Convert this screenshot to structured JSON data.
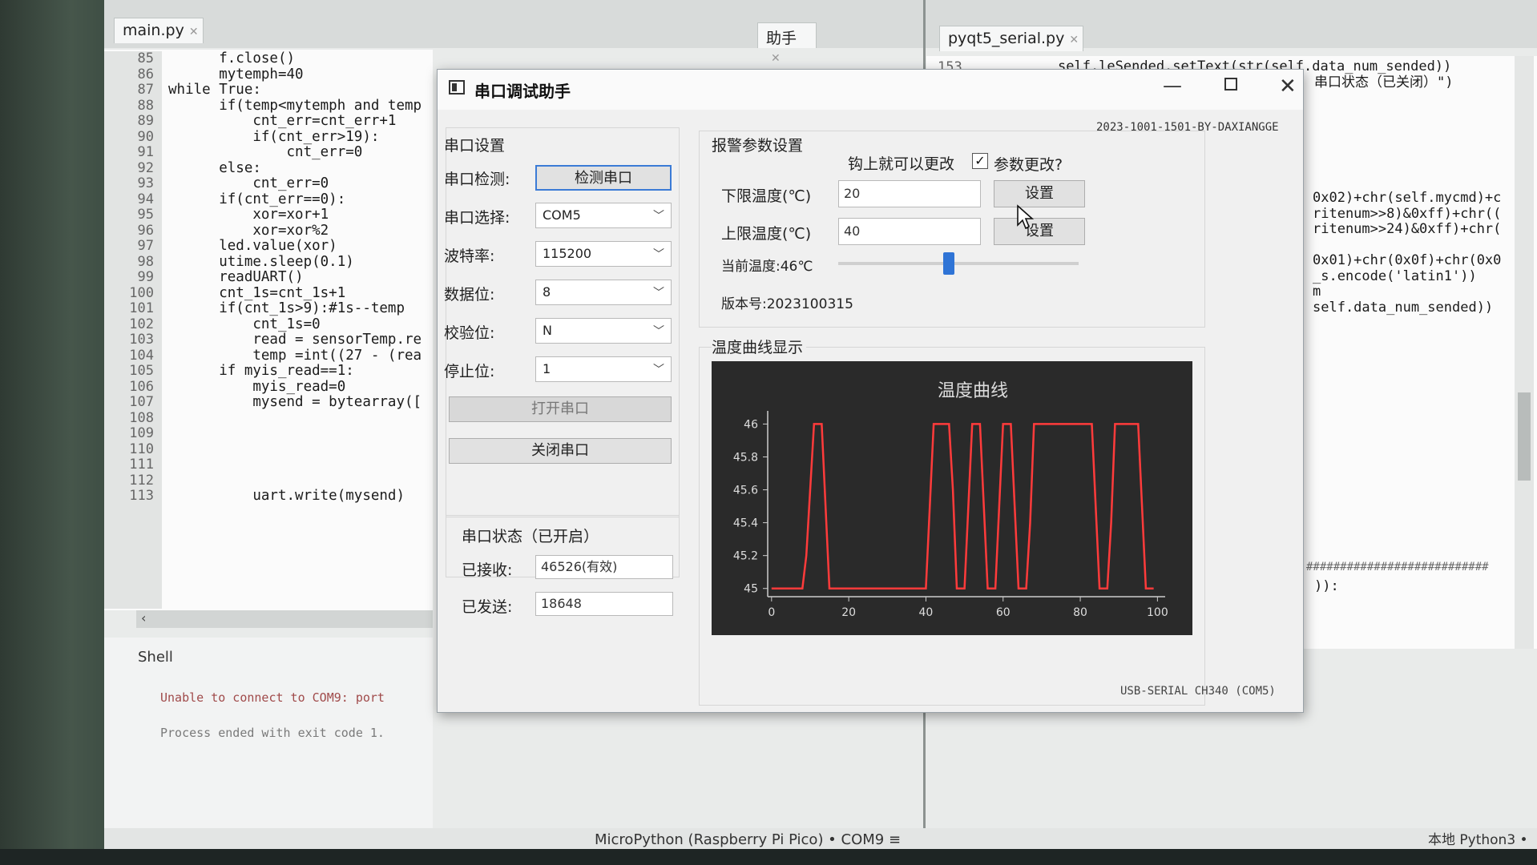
{
  "editor": {
    "left_tab": "main.py",
    "middle_tab": "助手",
    "right_tab": "pyqt5_serial.py",
    "line_numbers": [
      "85",
      "86",
      "87",
      "88",
      "89",
      "90",
      "91",
      "92",
      "93",
      "94",
      "95",
      "96",
      "97",
      "98",
      "99",
      "100",
      "101",
      "102",
      "103",
      "104",
      "105",
      "106",
      "107",
      "108",
      "109",
      "110",
      "111",
      "112",
      "113"
    ],
    "code_lines": [
      "      f.close()",
      "      mytemph=40",
      "while True:",
      "      if(temp<mytemph and temp",
      "          cnt_err=cnt_err+1",
      "          if(cnt_err>19):",
      "              cnt_err=0",
      "      else:",
      "          cnt_err=0",
      "      if(cnt_err==0):",
      "          xor=xor+1",
      "          xor=xor%2",
      "      led.value(xor)",
      "      utime.sleep(0.1)",
      "      readUART()",
      "      cnt_1s=cnt_1s+1",
      "      if(cnt_1s>9):#1s--temp",
      "          cnt_1s=0",
      "          read = sensorTemp.re",
      "          temp =int((27 - (rea",
      "      if myis_read==1:",
      "          myis_read=0",
      "          mysend = bytearray([",
      "",
      "",
      "",
      "",
      "",
      "          uart.write(mysend)"
    ],
    "right_line_number": "153",
    "right_code_lines": [
      "self.leSended.setText(str(self.data_num_sended))",
      "串口状态（已关闭）\")"
    ],
    "right_fragments": [
      "0x02)+chr(self.mycmd)+c",
      "ritenum>>8)&0xff)+chr((",
      "ritenum>>24)&0xff)+chr(",
      "",
      "0x01)+chr(0x0f)+chr(0x0",
      "_s.encode('latin1'))",
      "m",
      "self.data_num_sended))"
    ],
    "right_bottom_fragment": ")):",
    "right_hash_line": "###########################",
    "shell_tab": "Shell",
    "shell_lines": [
      "Unable to connect to COM9: port",
      "Process ended with exit code 1."
    ],
    "status_interpreter": "MicroPython (Raspberry Pi Pico)  •  COM9  ≡",
    "status_right": "本地 Python3  •"
  },
  "dialog": {
    "title": "串口调试助手",
    "version_tag": "2023-1001-1501-BY-DAXIANGGE",
    "serial_group": "串口设置",
    "detect_label": "串口检测:",
    "detect_button": "检测串口",
    "port_label": "串口选择:",
    "port_value": "COM5",
    "baud_label": "波特率:",
    "baud_value": "115200",
    "databits_label": "数据位:",
    "databits_value": "8",
    "parity_label": "校验位:",
    "parity_value": "N",
    "stopbits_label": "停止位:",
    "stopbits_value": "1",
    "open_button": "打开串口",
    "close_button": "关闭串口",
    "status_group": "串口状态（已开启）",
    "received_label": "已接收:",
    "received_value": "46526(有效)",
    "sent_label": "已发送:",
    "sent_value": "18648",
    "alarm_group": "报警参数设置",
    "hint_text": "钩上就可以更改",
    "param_change_label": "参数更改?",
    "param_change_checked": true,
    "lower_label": "下限温度(℃)",
    "lower_value": "20",
    "upper_label": "上限温度(℃)",
    "upper_value": "40",
    "set_button_1": "设置",
    "set_button_2": "设置",
    "current_temp_label": "当前温度:46℃",
    "current_temp_slider": 0.46,
    "version_label": "版本号:2023100315",
    "curve_group": "温度曲线显示",
    "port_footer": "USB-SERIAL CH340 (COM5)"
  },
  "chart_data": {
    "type": "line",
    "title": "温度曲线",
    "xlabel": "",
    "ylabel": "",
    "xlim": [
      -1,
      102
    ],
    "ylim": [
      44.95,
      46.08
    ],
    "xticks": [
      "0",
      "20",
      "40",
      "60",
      "80",
      "100"
    ],
    "yticks": [
      "45",
      "45.2",
      "45.4",
      "45.6",
      "45.8",
      "46"
    ],
    "grid": false,
    "line_color": "#ff3b3b",
    "background": "#2a2a2a",
    "x": [
      0,
      8,
      9,
      10,
      11,
      12,
      13,
      14,
      15,
      40,
      41,
      42,
      43,
      44,
      45,
      46,
      47,
      48,
      49,
      50,
      51,
      52,
      53,
      54,
      55,
      56,
      57,
      58,
      59,
      60,
      61,
      62,
      63,
      64,
      65,
      66,
      67,
      68,
      69,
      70,
      78,
      79,
      80,
      81,
      82,
      83,
      84,
      85,
      86,
      87,
      88,
      89,
      90,
      91,
      92,
      93,
      94,
      95,
      96,
      97,
      98,
      99
    ],
    "y": [
      45,
      45,
      45.2,
      45.6,
      46,
      46,
      46,
      45.5,
      45,
      45,
      45.5,
      46,
      46,
      46,
      46,
      46,
      45.6,
      45,
      45,
      45,
      45.5,
      46,
      46,
      46,
      45.5,
      45,
      45,
      45,
      45.5,
      46,
      46,
      46,
      45.5,
      45,
      45,
      45,
      45.4,
      46,
      46,
      46,
      46,
      46,
      46,
      46,
      46,
      46,
      45.5,
      45,
      45,
      45,
      45.4,
      46,
      46,
      46,
      46,
      46,
      46,
      46,
      45.5,
      45,
      45,
      45
    ]
  }
}
